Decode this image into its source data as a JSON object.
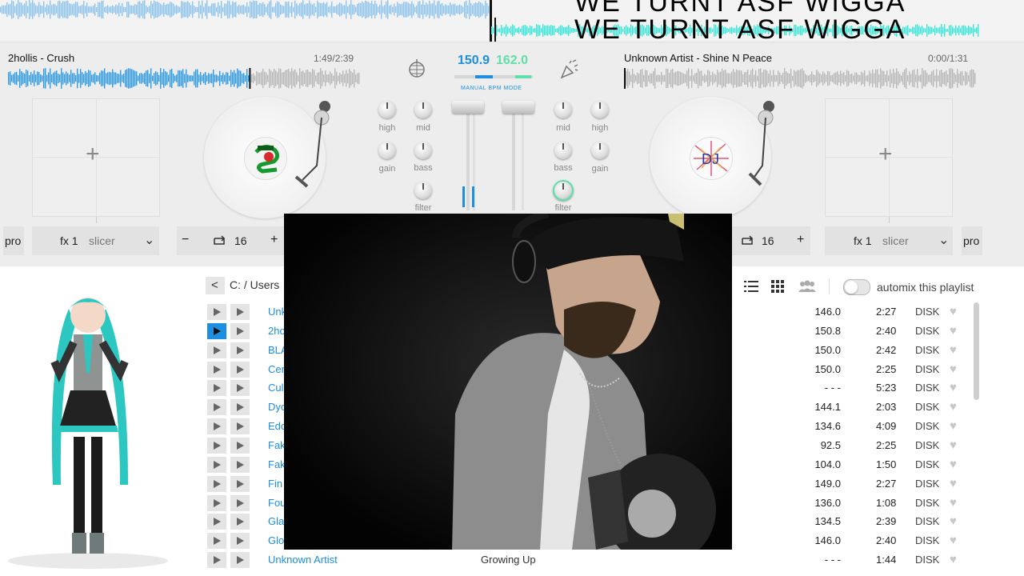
{
  "overlay": {
    "line1": "WE TURNT ASF WIGGA",
    "line2": "WE TURNT ASF WIGGA"
  },
  "deck_left": {
    "title": "2hollis - Crush",
    "time": "1:49/2:39",
    "fx_label": "fx 1",
    "fx_effect": "slicer",
    "loop_value": "16",
    "pro_label": "pro"
  },
  "deck_right": {
    "title": "Unknown Artist - Shine N Peace",
    "time": "0:00/1:31",
    "fx_label": "fx 1",
    "fx_effect": "slicer",
    "loop_value": "16",
    "pro_label": "pro"
  },
  "mixer": {
    "bpm_left": "150.9",
    "bpm_right": "162.0",
    "bpm_mode": "MANUAL BPM MODE",
    "labels": {
      "high": "high",
      "mid": "mid",
      "gain": "gain",
      "bass": "bass",
      "filter": "filter"
    }
  },
  "browser": {
    "path": "C: / Users",
    "automix_label": "automix this playlist",
    "rows": [
      {
        "artist": "Unk",
        "bpm": "146.0",
        "duration": "2:27",
        "source": "DISK",
        "active": false
      },
      {
        "artist": "2ho",
        "bpm": "150.8",
        "duration": "2:40",
        "source": "DISK",
        "active": true
      },
      {
        "artist": "BLA",
        "bpm": "150.0",
        "duration": "2:42",
        "source": "DISK",
        "active": false
      },
      {
        "artist": "Cer",
        "bpm": "150.0",
        "duration": "2:25",
        "source": "DISK",
        "active": false
      },
      {
        "artist": "Cul",
        "bpm": "- - -",
        "duration": "5:23",
        "source": "DISK",
        "active": false
      },
      {
        "artist": "Dyc",
        "bpm": "144.1",
        "duration": "2:03",
        "source": "DISK",
        "active": false
      },
      {
        "artist": "Edo",
        "bpm": "134.6",
        "duration": "4:09",
        "source": "DISK",
        "active": false
      },
      {
        "artist": "Fak",
        "bpm": "92.5",
        "duration": "2:25",
        "source": "DISK",
        "active": false
      },
      {
        "artist": "Fak",
        "bpm": "104.0",
        "duration": "1:50",
        "source": "DISK",
        "active": false
      },
      {
        "artist": "Fin",
        "bpm": "149.0",
        "duration": "2:27",
        "source": "DISK",
        "active": false
      },
      {
        "artist": "Fou",
        "bpm": "136.0",
        "duration": "1:08",
        "source": "DISK",
        "active": false
      },
      {
        "artist": "Gla",
        "bpm": "134.5",
        "duration": "2:39",
        "source": "DISK",
        "active": false
      },
      {
        "artist": "Glo",
        "bpm": "146.0",
        "duration": "2:40",
        "source": "DISK",
        "active": false
      },
      {
        "artist": "Unknown Artist",
        "title": "Growing Up",
        "bpm": "- - -",
        "duration": "1:44",
        "source": "DISK",
        "active": false
      }
    ]
  },
  "colors": {
    "accent_blue": "#1e8ee0",
    "bpm_green": "#5ee0a8",
    "wave_blue": "#2d9ae6",
    "wave_grey": "#b7b7b7",
    "overlay_cyan": "#39e6d8"
  },
  "icons": {
    "left_deck_button": "disco-ball-icon",
    "right_deck_button": "party-popper-icon",
    "list_view": "list-view-icon",
    "grid_view": "grid-view-icon",
    "people": "people-icon",
    "favorite": "heart-icon"
  }
}
